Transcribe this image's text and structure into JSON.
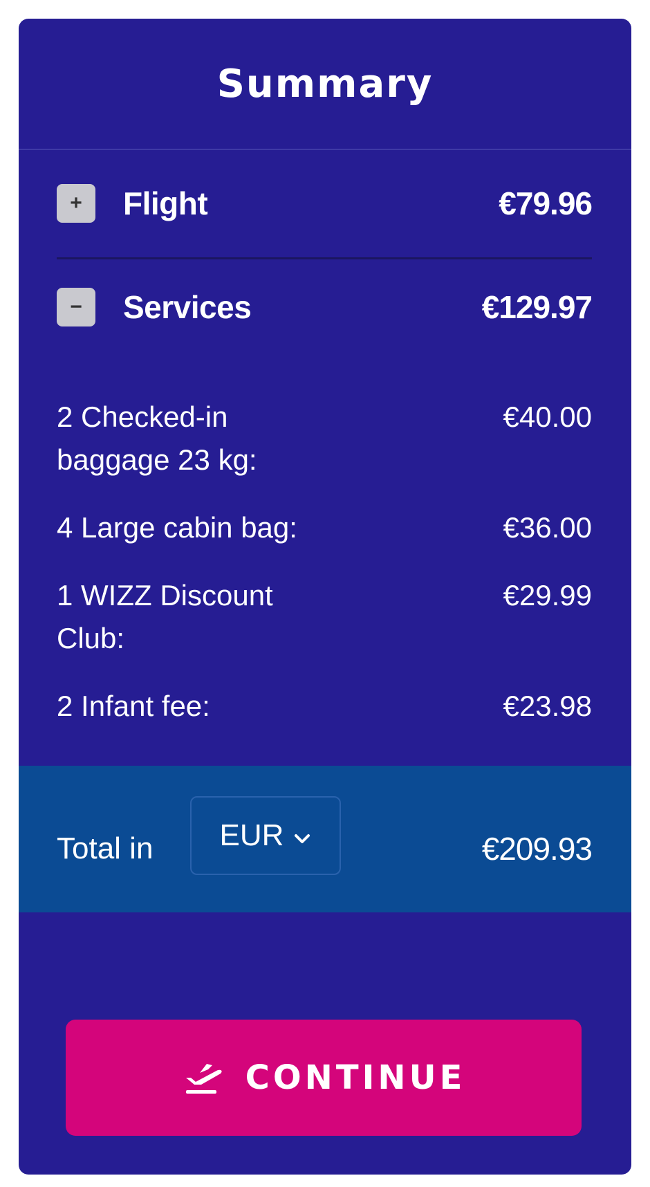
{
  "summary": {
    "title": "Summary",
    "flight": {
      "toggle": "+",
      "label": "Flight",
      "amount": "€79.96",
      "expanded": false
    },
    "services": {
      "toggle": "−",
      "label": "Services",
      "amount": "€129.97",
      "expanded": true,
      "items": [
        {
          "label": "2 Checked-in baggage 23 kg:",
          "amount": "€40.00"
        },
        {
          "label": "4 Large cabin bag:",
          "amount": "€36.00"
        },
        {
          "label": "1 WIZZ Discount Club:",
          "amount": "€29.99"
        },
        {
          "label": "2 Infant fee:",
          "amount": "€23.98"
        }
      ]
    },
    "total": {
      "label": "Total in",
      "currency": "EUR",
      "amount": "€209.93"
    },
    "continue": {
      "label": "CONTINUE",
      "icon": "plane-takeoff-icon"
    }
  },
  "colors": {
    "panel": "#261d93",
    "total_band": "#0b4b94",
    "continue_button": "#d4057b"
  }
}
